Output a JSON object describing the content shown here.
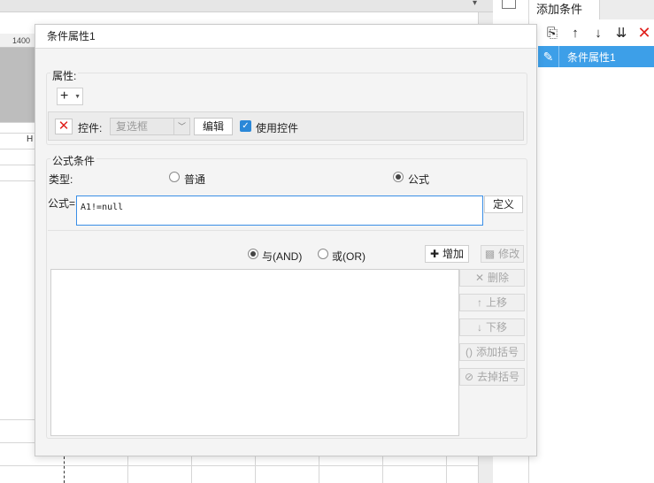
{
  "background": {
    "ruler_label": "1400",
    "column_header": "H"
  },
  "right_panel": {
    "tab_label": "添加条件",
    "toolbar": [
      {
        "icon": "copy-icon",
        "glyph": "⎘"
      },
      {
        "icon": "arrow-up-icon",
        "glyph": "↑"
      },
      {
        "icon": "arrow-down-icon",
        "glyph": "↓"
      },
      {
        "icon": "move-bottom-icon",
        "glyph": "⇊"
      },
      {
        "icon": "delete-icon",
        "glyph": "✕"
      }
    ],
    "item_label": "条件属性1"
  },
  "dialog": {
    "title": "条件属性1",
    "attributes": {
      "label": "属性:",
      "add_glyph": "+",
      "control_label": "控件:",
      "control_value": "复选框",
      "edit_label": "编辑",
      "use_control_label": "使用控件",
      "use_control_checked": true
    },
    "formula_condition": {
      "label": "公式条件",
      "type_label": "类型:",
      "type_options": [
        "普通",
        "公式"
      ],
      "type_selected": "公式",
      "formula_label": "公式=",
      "formula_value": "A1!=null",
      "define_label": "定义",
      "and_label": "与(AND)",
      "or_label": "或(OR)",
      "logic_selected": "AND",
      "add_label": "增加",
      "modify_label": "修改",
      "delete_label": "删除",
      "up_label": "上移",
      "down_label": "下移",
      "add_bracket_label": "添加括号",
      "remove_bracket_label": "去掉括号"
    }
  },
  "colors": {
    "accent": "#3d9fe8",
    "delete_red": "#e0201c",
    "checkbox_blue": "#2b88d8"
  }
}
